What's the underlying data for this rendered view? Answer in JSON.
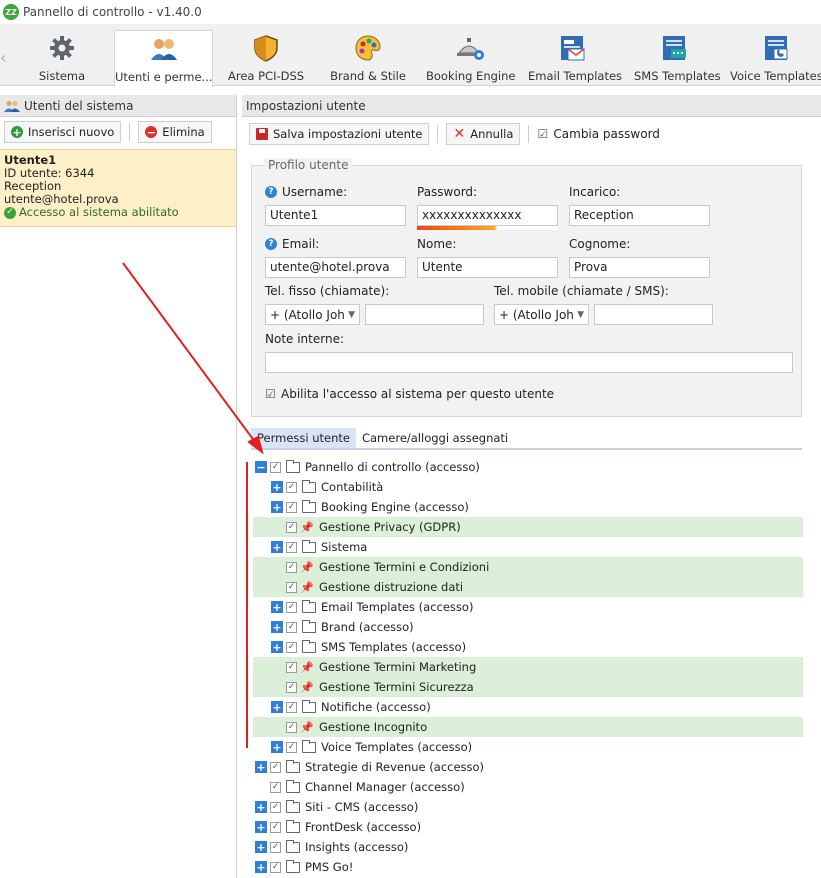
{
  "window": {
    "title": "Pannello di controllo - v1.40.0",
    "app_icon_text": "ZZ"
  },
  "toolbar": {
    "items": [
      {
        "label": "Sistema",
        "icon": "gear-icon"
      },
      {
        "label": "Utenti e perme...",
        "icon": "users-icon",
        "active": true
      },
      {
        "label": "Area PCI-DSS",
        "icon": "shield-icon"
      },
      {
        "label": "Brand & Stile",
        "icon": "palette-icon"
      },
      {
        "label": "Booking Engine",
        "icon": "booking-icon"
      },
      {
        "label": "Email Templates",
        "icon": "email-template-icon"
      },
      {
        "label": "SMS Templates",
        "icon": "sms-template-icon"
      },
      {
        "label": "Voice Templates",
        "icon": "voice-template-icon"
      }
    ]
  },
  "left": {
    "header": "Utenti del sistema",
    "add_label": "Inserisci nuovo",
    "delete_label": "Elimina",
    "user": {
      "name": "Utente1",
      "id": "ID utente: 6344",
      "role": "Reception",
      "email": "utente@hotel.prova",
      "status": "Accesso al sistema abilitato"
    }
  },
  "right": {
    "header": "Impostazioni utente",
    "save_label": "Salva impostazioni utente",
    "cancel_label": "Annulla",
    "change_password_label": "Cambia password",
    "profile": {
      "legend": "Profilo utente",
      "username_label": "Username:",
      "username_value": "Utente1",
      "password_label": "Password:",
      "password_value": "xxxxxxxxxxxxxx",
      "password_strength": 0.55,
      "role_label": "Incarico:",
      "role_value": "Reception",
      "email_label": "Email:",
      "email_value": "utente@hotel.prova",
      "name_label": "Nome:",
      "name_value": "Utente",
      "surname_label": "Cognome:",
      "surname_value": "Prova",
      "phone_label": "Tel. fisso (chiamate):",
      "phone_prefix": "+ (Atollo Joh",
      "mobile_label": "Tel. mobile (chiamate / SMS):",
      "mobile_prefix": "+ (Atollo Joh",
      "notes_label": "Note interne:",
      "enable_label": "Abilita l'accesso al sistema per questo utente"
    },
    "tabs": [
      {
        "label": "Permessi utente",
        "active": true
      },
      {
        "label": "Camere/alloggi assegnati"
      }
    ]
  },
  "tree": [
    {
      "label": "Pannello di controllo (accesso)",
      "level": 0,
      "expander": "minus",
      "kind": "folder-open"
    },
    {
      "label": "Contabilità",
      "level": 1,
      "expander": "plus",
      "kind": "folder"
    },
    {
      "label": "Booking Engine (accesso)",
      "level": 1,
      "expander": "plus",
      "kind": "folder"
    },
    {
      "label": "Gestione Privacy (GDPR)",
      "level": 1,
      "expander": "none",
      "kind": "pin",
      "highlight": true
    },
    {
      "label": "Sistema",
      "level": 1,
      "expander": "plus",
      "kind": "folder"
    },
    {
      "label": "Gestione Termini e Condizioni",
      "level": 1,
      "expander": "none",
      "kind": "pin",
      "highlight": true
    },
    {
      "label": "Gestione distruzione dati",
      "level": 1,
      "expander": "none",
      "kind": "pin",
      "highlight": true
    },
    {
      "label": "Email Templates (accesso)",
      "level": 1,
      "expander": "plus",
      "kind": "folder"
    },
    {
      "label": "Brand (accesso)",
      "level": 1,
      "expander": "plus",
      "kind": "folder"
    },
    {
      "label": "SMS Templates (accesso)",
      "level": 1,
      "expander": "plus",
      "kind": "folder"
    },
    {
      "label": "Gestione Termini Marketing",
      "level": 1,
      "expander": "none",
      "kind": "pin",
      "highlight": true
    },
    {
      "label": "Gestione Termini Sicurezza",
      "level": 1,
      "expander": "none",
      "kind": "pin",
      "highlight": true
    },
    {
      "label": "Notifiche (accesso)",
      "level": 1,
      "expander": "plus",
      "kind": "folder"
    },
    {
      "label": "Gestione Incognito",
      "level": 1,
      "expander": "none",
      "kind": "pin",
      "highlight": true
    },
    {
      "label": "Voice Templates (accesso)",
      "level": 1,
      "expander": "plus",
      "kind": "folder"
    },
    {
      "label": "Strategie di Revenue (accesso)",
      "level": 0,
      "expander": "plus",
      "kind": "folder"
    },
    {
      "label": "Channel Manager (accesso)",
      "level": 0,
      "expander": "none",
      "kind": "folder"
    },
    {
      "label": "Siti - CMS (accesso)",
      "level": 0,
      "expander": "plus",
      "kind": "folder"
    },
    {
      "label": "FrontDesk (accesso)",
      "level": 0,
      "expander": "plus",
      "kind": "folder"
    },
    {
      "label": "Insights (accesso)",
      "level": 0,
      "expander": "plus",
      "kind": "folder"
    },
    {
      "label": "PMS Go!",
      "level": 0,
      "expander": "plus",
      "kind": "folder"
    }
  ],
  "colors": {
    "accent": "#2d7fd9",
    "highlight_row": "#dcefd8",
    "user_card": "#fdf0c8",
    "annotation": "#e02020"
  }
}
